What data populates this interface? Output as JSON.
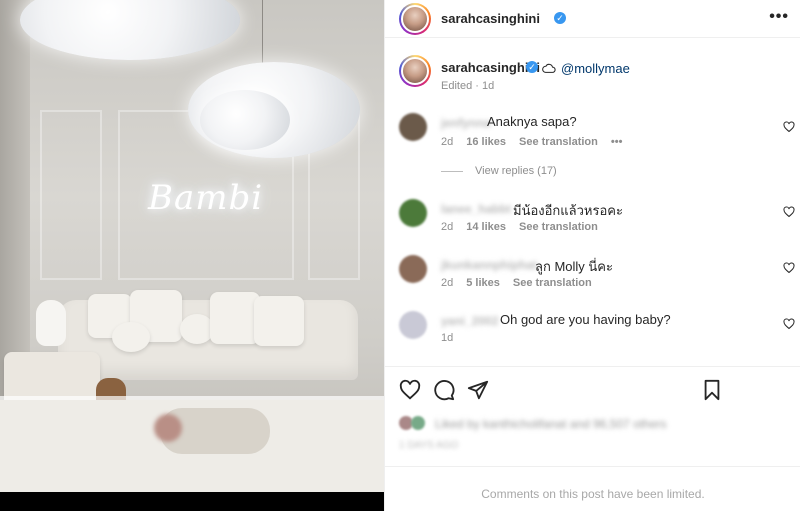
{
  "post": {
    "author": "sarahcasinghini",
    "verified_glyph": "✓",
    "more_glyph": "•••",
    "photo_neon_text": "Bambi"
  },
  "caption": {
    "author": "sarahcasinghini",
    "mention": "@mollymae",
    "edited": "Edited · 1d"
  },
  "comments": [
    {
      "user": "jenfynna",
      "text": "Anaknya sapa?",
      "time": "2d",
      "likes": "16 likes",
      "translate": "See translation",
      "more": "•••",
      "avatar_color": "#6b5a4a"
    },
    {
      "user": "lanee_habbt",
      "text": "มีน้องอีกแล้วหรอคะ",
      "time": "2d",
      "likes": "14 likes",
      "translate": "See translation",
      "avatar_color": "#4c7a3a"
    },
    {
      "user": "jkunkannphiphat",
      "text": "ลูก Molly นี่คะ",
      "time": "2d",
      "likes": "5 likes",
      "translate": "See translation",
      "avatar_color": "#8a6a58"
    },
    {
      "user": "yani_2002",
      "text": "Oh god are you having baby?",
      "time": "1d",
      "avatar_color": "#c9c9d6"
    }
  ],
  "replies": {
    "label": "View replies (17)"
  },
  "likes_blur": "Liked by kanthicholifanat and 96,507 others",
  "date_blur": "1 DAYS AGO",
  "footer": {
    "limited": "Comments on this post have been limited."
  },
  "colors": {
    "link": "#00376b",
    "verified": "#3897f0",
    "meta": "#8e8e8e"
  },
  "icons": [
    "heart-icon",
    "comment-icon",
    "share-icon",
    "bookmark-icon",
    "cloud-icon",
    "more-icon"
  ]
}
